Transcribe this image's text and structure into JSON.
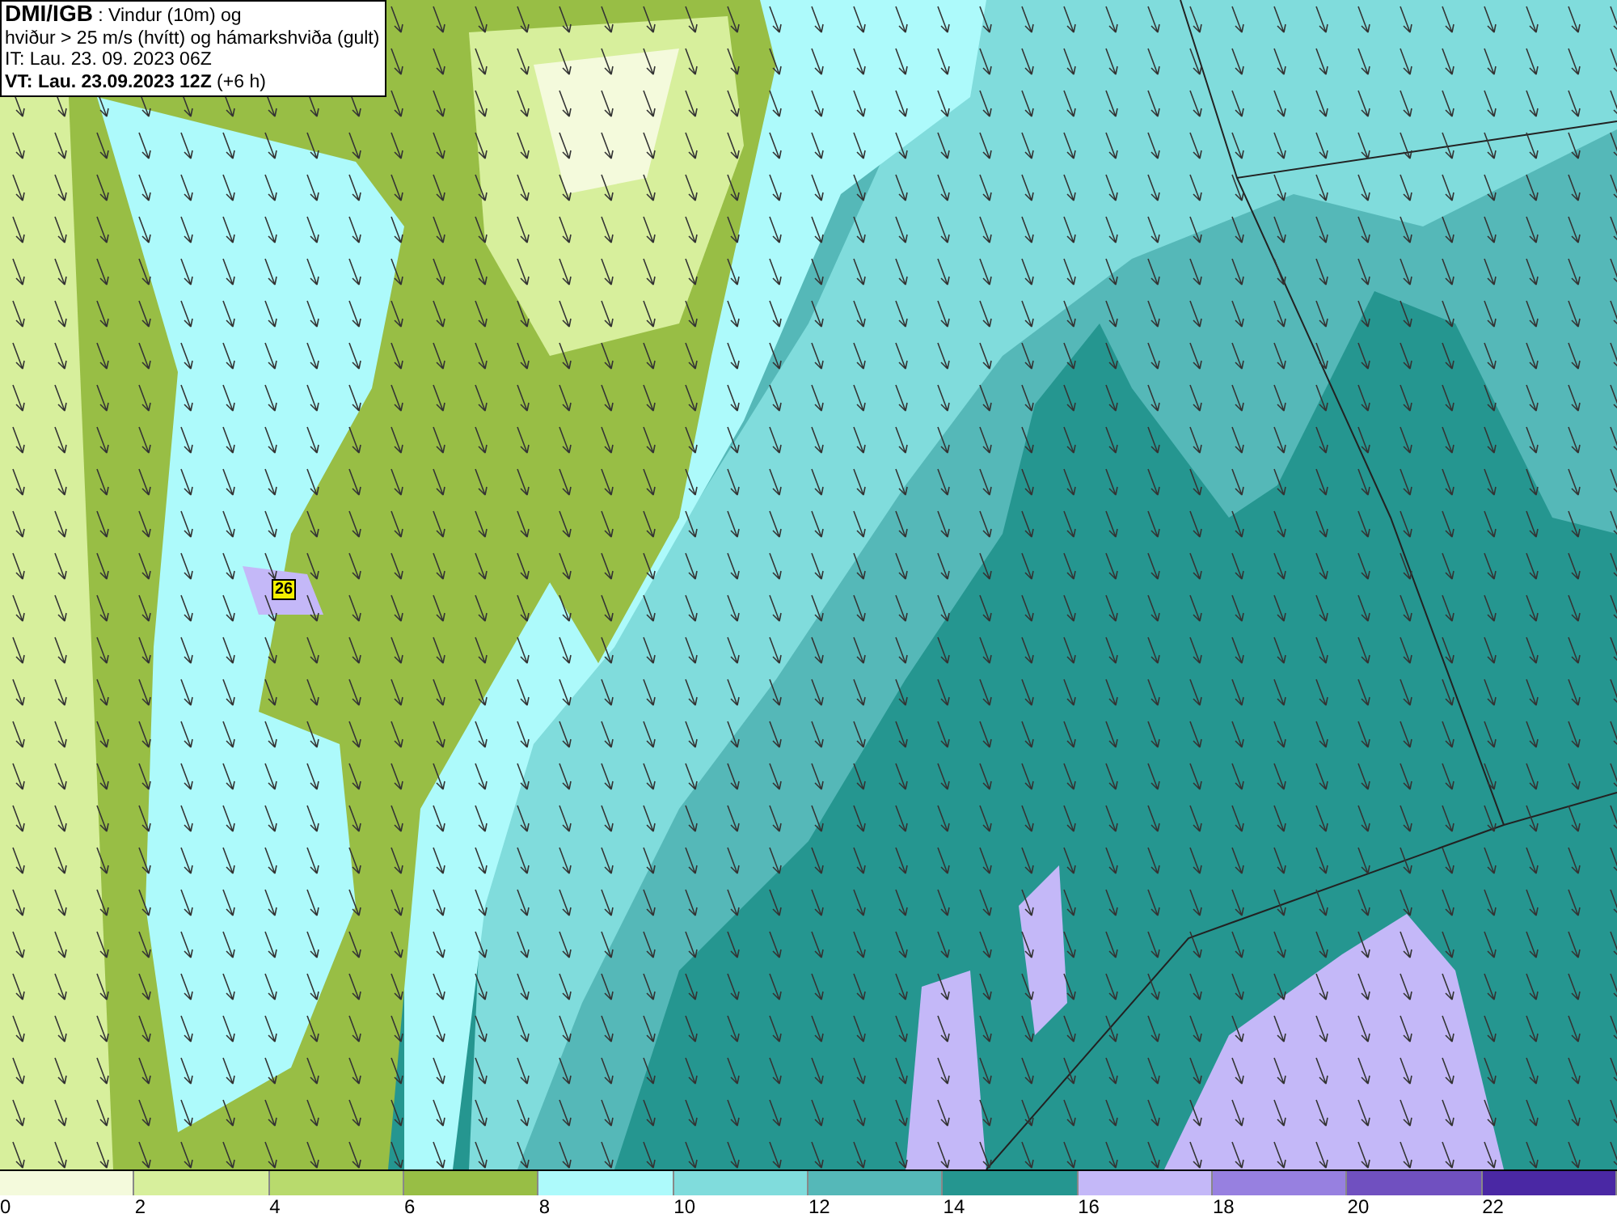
{
  "title_box": {
    "lines": [
      "**DMI/IGB** : Vindur (10m) og",
      "hviður > 25 m/s (hvítt) og hámarkshviða (gult)",
      "IT: Lau. 23. 09. 2023 06Z",
      "**VT: Lau. 23.09.2023 12Z** (+6 h)"
    ]
  },
  "map": {
    "gust_labels": [
      {
        "text": "26"
      }
    ]
  },
  "legend": {
    "bins": [
      {
        "label": "0",
        "color": "#f4fadc"
      },
      {
        "label": "2",
        "color": "#d7ef9c"
      },
      {
        "label": "4",
        "color": "#b8da6d"
      },
      {
        "label": "6",
        "color": "#98be45"
      },
      {
        "label": "8",
        "color": "#adfafb"
      },
      {
        "label": "10",
        "color": "#80dcdc"
      },
      {
        "label": "12",
        "color": "#55b8b8"
      },
      {
        "label": "14",
        "color": "#259690"
      },
      {
        "label": "16",
        "color": "#c4b8f8"
      },
      {
        "label": "18",
        "color": "#9780e0"
      },
      {
        "label": "20",
        "color": "#7050c0"
      },
      {
        "label": "22",
        "color": "#4a28a4"
      }
    ]
  }
}
